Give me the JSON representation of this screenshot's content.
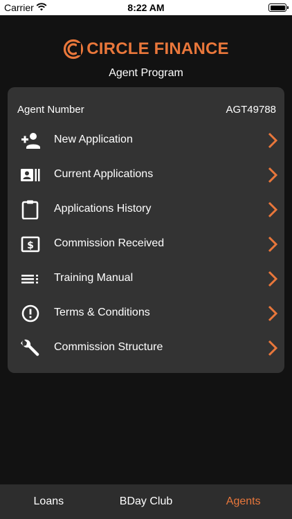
{
  "status": {
    "carrier": "Carrier",
    "time": "8:22 AM"
  },
  "header": {
    "brand_name": "CIRCLE FINANCE",
    "subtitle": "Agent Program"
  },
  "agent": {
    "label": "Agent Number",
    "value": "AGT49788"
  },
  "menu": [
    {
      "label": "New Application",
      "icon": "add-person-icon"
    },
    {
      "label": "Current Applications",
      "icon": "contact-card-icon"
    },
    {
      "label": "Applications History",
      "icon": "clipboard-icon"
    },
    {
      "label": "Commission Received",
      "icon": "dollar-bill-icon"
    },
    {
      "label": "Training Manual",
      "icon": "list-icon"
    },
    {
      "label": "Terms & Conditions",
      "icon": "alert-circle-icon"
    },
    {
      "label": "Commission Structure",
      "icon": "wrench-icon"
    }
  ],
  "tabs": [
    {
      "label": "Loans",
      "active": false
    },
    {
      "label": "BDay Club",
      "active": false
    },
    {
      "label": "Agents",
      "active": true
    }
  ],
  "colors": {
    "accent": "#e9773b",
    "background": "#121212",
    "card": "#333333",
    "tab_bar": "#2d2d2d"
  }
}
